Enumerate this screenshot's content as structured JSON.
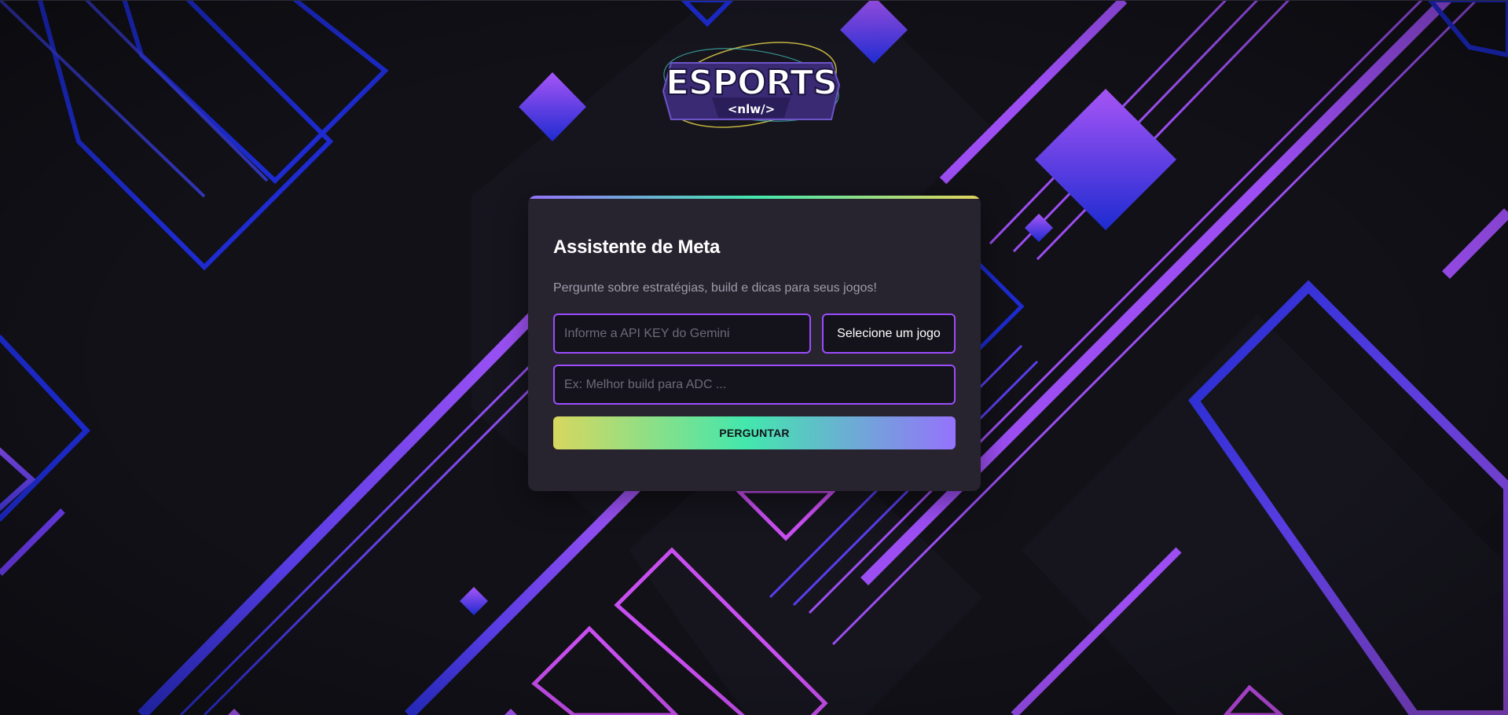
{
  "logo": {
    "title": "ESPORTS",
    "subtitle": "<nlw/>"
  },
  "card": {
    "title": "Assistente de Meta",
    "description": "Pergunte sobre estratégias, build e dicas para seus jogos!",
    "api_key_placeholder": "Informe a API KEY do Gemini",
    "game_select_label": "Selecione um jogo",
    "question_placeholder": "Ex: Melhor build para ADC ...",
    "ask_button_label": "PERGUNTAR"
  },
  "colors": {
    "background": "#121118",
    "card": "#27232f",
    "accent_purple": "#9b4dff",
    "accent_blue": "#1f2bd6",
    "gradient_yellow": "#d7d75f",
    "gradient_green": "#43e7ad",
    "gradient_violet": "#9572fc"
  }
}
